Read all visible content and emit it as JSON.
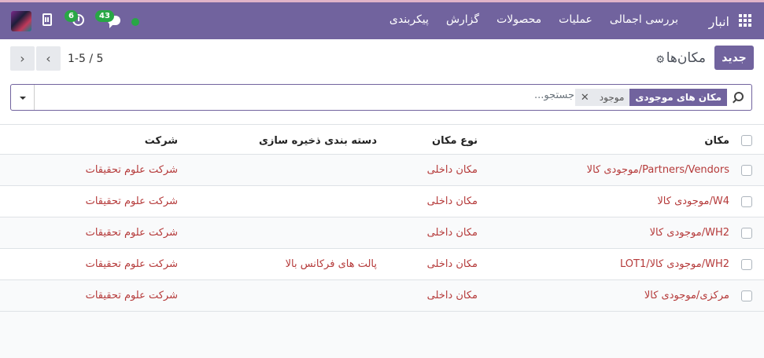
{
  "app": {
    "name": "انبار"
  },
  "menu": [
    {
      "label": "بررسی اجمالی"
    },
    {
      "label": "عملیات"
    },
    {
      "label": "محصولات"
    },
    {
      "label": "گزارش"
    },
    {
      "label": "پیکربندی"
    }
  ],
  "systray": {
    "activity_count": "6",
    "message_count": "43"
  },
  "control": {
    "new_label": "جدید",
    "title": "مکان‌ها",
    "pager_value": "1-5",
    "pager_sep": "/",
    "pager_total": "5"
  },
  "search": {
    "placeholder": "جستجو...",
    "facet_label": "مکان های موجودی",
    "facet_value": "موجود"
  },
  "table": {
    "headers": {
      "location": "مکان",
      "type": "نوع مکان",
      "storage": "دسته بندی ذخیره سازی",
      "company": "شرکت"
    },
    "rows": [
      {
        "location": "Partners/Vendors/موجودی کالا",
        "type": "مکان داخلی",
        "storage": "",
        "company": "شرکت علوم تحقیقات"
      },
      {
        "location": "W4/موجودی کالا",
        "type": "مکان داخلی",
        "storage": "",
        "company": "شرکت علوم تحقیقات"
      },
      {
        "location": "WH2/موجودی کالا",
        "type": "مکان داخلی",
        "storage": "",
        "company": "شرکت علوم تحقیقات"
      },
      {
        "location": "WH2/موجودی کالا/LOT1",
        "type": "مکان داخلی",
        "storage": "پالت های فرکانس بالا",
        "company": "شرکت علوم تحقیقات"
      },
      {
        "location": "مرکزی/موجودی کالا",
        "type": "مکان داخلی",
        "storage": "",
        "company": "شرکت علوم تحقیقات"
      }
    ]
  },
  "colors": {
    "brand": "#71639e",
    "link": "#b53a3a",
    "badge": "#28a745"
  }
}
